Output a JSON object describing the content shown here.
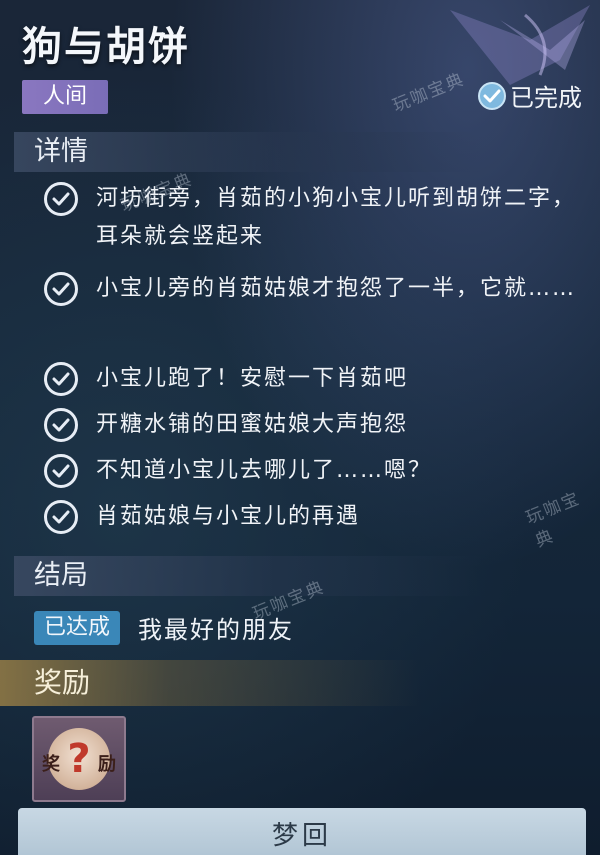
{
  "quest": {
    "title": "狗与胡饼",
    "realm_tag": "人间",
    "status": "已完成"
  },
  "details": {
    "header": "详情",
    "items": [
      {
        "text": "河坊街旁，肖茹的小狗小宝儿听到胡饼二字，耳朵就会竖起来"
      },
      {
        "text": "小宝儿旁的肖茹姑娘才抱怨了一半，它就……"
      },
      {
        "text": "小宝儿跑了！安慰一下肖茹吧"
      },
      {
        "text": "开糖水铺的田蜜姑娘大声抱怨"
      },
      {
        "text": "不知道小宝儿去哪儿了……嗯？"
      },
      {
        "text": "肖茹姑娘与小宝儿的再遇"
      }
    ]
  },
  "ending": {
    "header": "结局",
    "badge": "已达成",
    "text": "我最好的朋友"
  },
  "reward": {
    "header": "奖励",
    "item_label_left": "奖",
    "item_label_right": "励",
    "item_symbol": "?"
  },
  "action": {
    "button_label": "梦回"
  },
  "watermark": {
    "text": "玩咖宝典"
  },
  "icons": {
    "completed": "check-circle-icon",
    "step": "check-icon",
    "decoration": "butterfly-wing-icon"
  },
  "colors": {
    "realm_tag": "#8a77c0",
    "ending_badge": "#3a87b8",
    "completed_icon": "#7fb9df"
  }
}
